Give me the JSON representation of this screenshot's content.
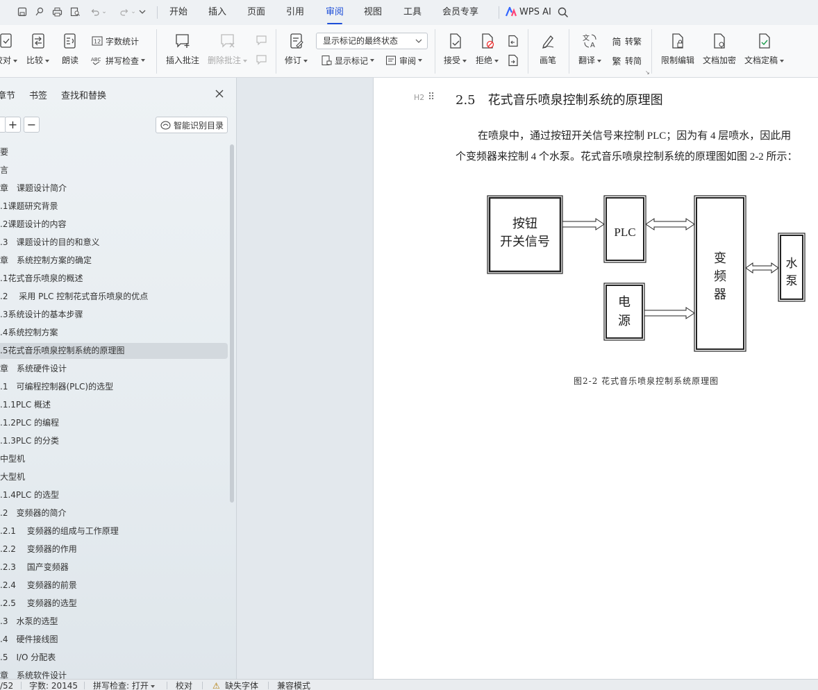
{
  "tabs": {
    "items": [
      "开始",
      "插入",
      "页面",
      "引用",
      "审阅",
      "视图",
      "工具",
      "会员专享"
    ],
    "active": "审阅",
    "wps_ai": "WPS AI"
  },
  "ribbon": {
    "proofread": "校对",
    "compare": "比较",
    "read_aloud": "朗读",
    "word_count": "字数统计",
    "spell_check": "拼写检查",
    "insert_comment": "插入批注",
    "delete_comment": "删除批注",
    "track_changes": "修订",
    "markup_state": "显示标记的最终状态",
    "show_markup": "显示标记",
    "review_pane": "审阅",
    "accept": "接受",
    "reject": "拒绝",
    "ink": "画笔",
    "translate": "翻译",
    "to_traditional": "转繁",
    "to_simplified": "转简",
    "restrict_edit": "限制编辑",
    "doc_encrypt": "文档加密",
    "doc_finalize": "文档定稿"
  },
  "nav": {
    "tab_chapters": "章节",
    "tab_bookmarks": "书签",
    "tab_find": "查找和替换",
    "smart_toc": "智能识别目录",
    "items": [
      "要",
      "言",
      "章　课题设计简介",
      ".1课题研究背景",
      ".2课题设计的内容",
      ".3　课题设计的目的和意义",
      "章　系统控制方案的确定",
      ".1花式音乐喷泉的概述",
      ".2　 采用 PLC 控制花式音乐喷泉的优点",
      ".3系统设计的基本步骤",
      ".4系统控制方案",
      ".5花式音乐喷泉控制系统的原理图",
      "章　系统硬件设计",
      ".1　可编程控制器(PLC)的选型",
      ".1.1PLC 概述",
      ".1.2PLC 的编程",
      ".1.3PLC 的分类",
      "中型机",
      "大型机",
      ".1.4PLC 的选型",
      ".2　变频器的简介",
      ".2.1　 变频器的组成与工作原理",
      ".2.2　 变频器的作用",
      ".2.3　 国产变频器",
      ".2.4　 变频器的前景",
      ".2.5　 变频器的选型",
      ".3　水泵的选型",
      ".4　硬件接线图",
      ".5　I/O 分配表",
      "章　系统软件设计"
    ],
    "active_index": 11
  },
  "doc": {
    "heading_marker": "H2",
    "heading": "2.5　花式音乐喷泉控制系统的原理图",
    "para1": "在喷泉中，通过按钮开关信号来控制 PLC；因为有 4 层喷水，因此用",
    "para2": "个变频器来控制 4 个水泵。花式音乐喷泉控制系统的原理图如图 2-2 所示：",
    "diagram": {
      "button_l1": "按钮",
      "button_l2": "开关信号",
      "plc": "PLC",
      "power_l1": "电",
      "power_l2": "源",
      "vfd_1": "变",
      "vfd_2": "频",
      "vfd_3": "器",
      "pump_1": "水",
      "pump_2": "泵"
    },
    "caption": "图2-2 花式音乐喷泉控制系统原理图"
  },
  "status": {
    "page": "/52",
    "word_count": "字数: 20145",
    "spell_check": "拼写检查: 打开",
    "proofread": "校对",
    "missing_font": "缺失字体",
    "compat_mode": "兼容模式"
  }
}
